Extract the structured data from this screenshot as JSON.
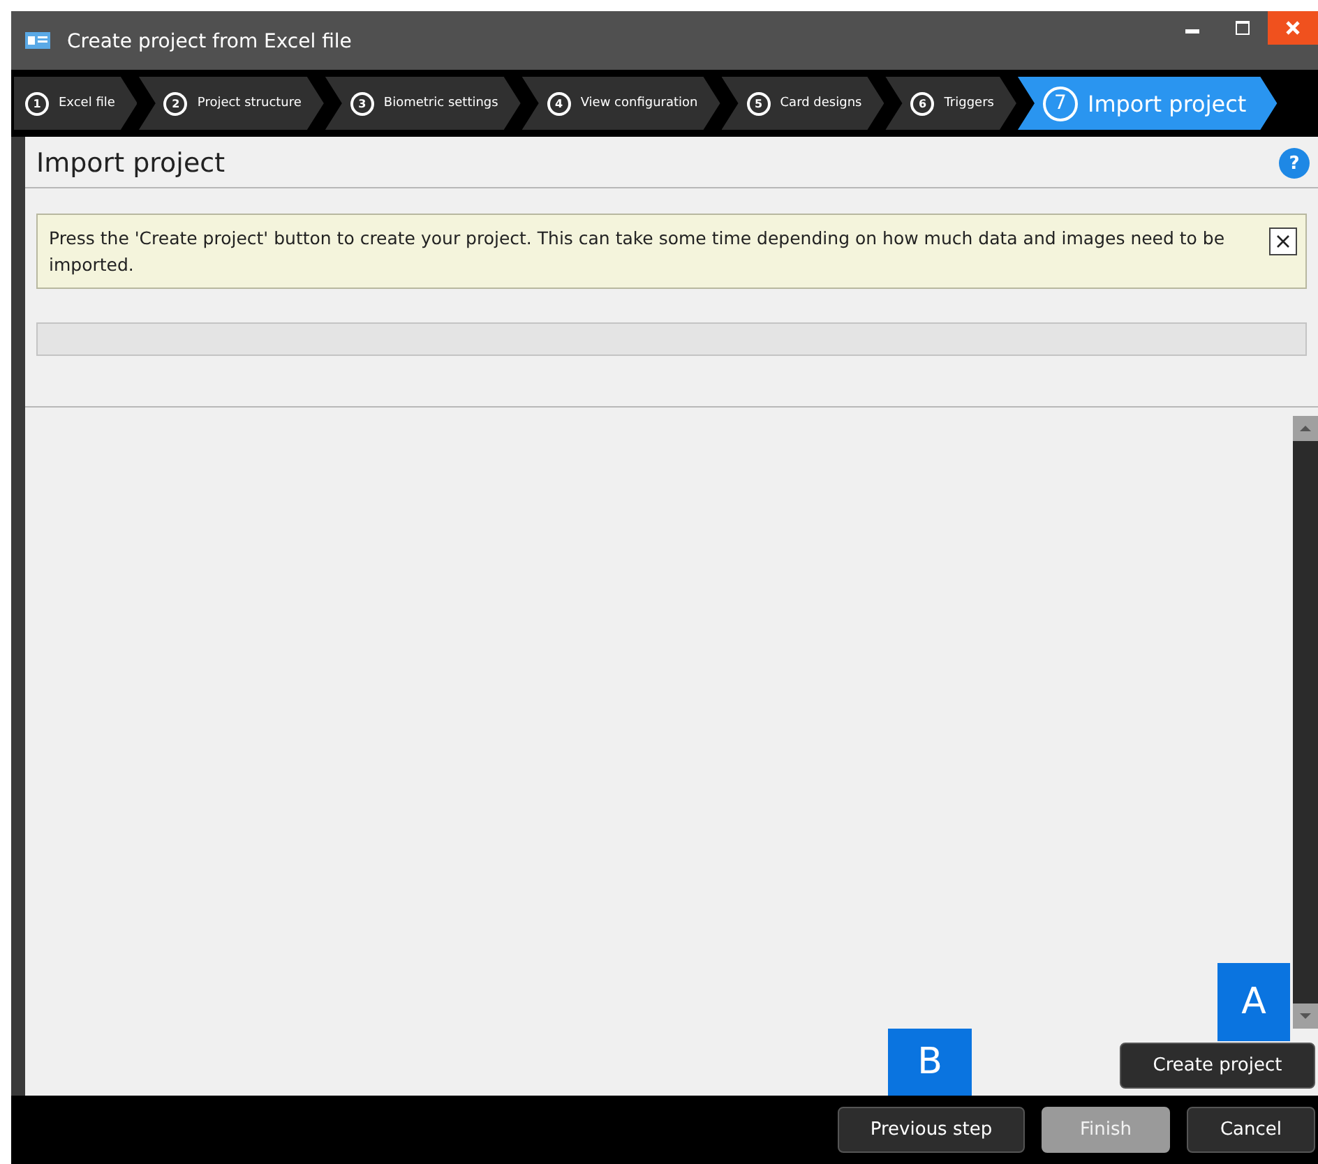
{
  "window": {
    "title": "Create project from Excel file"
  },
  "steps": [
    {
      "number": "1",
      "label": "Excel file",
      "selected": false
    },
    {
      "number": "2",
      "label": "Project structure",
      "selected": false
    },
    {
      "number": "3",
      "label": "Biometric settings",
      "selected": false
    },
    {
      "number": "4",
      "label": "View configuration",
      "selected": false
    },
    {
      "number": "5",
      "label": "Card designs",
      "selected": false
    },
    {
      "number": "6",
      "label": "Triggers",
      "selected": false
    },
    {
      "number": "7",
      "label": "Import project",
      "selected": true
    }
  ],
  "page": {
    "heading": "Import project",
    "help": "?"
  },
  "notice": {
    "text": "Press the 'Create project' button to create your project. This can take some time depending on how much data and images need to be imported."
  },
  "progress": {
    "level": 0
  },
  "create_button": {
    "label": "Create project",
    "callout": "A"
  },
  "footer_buttons": [
    {
      "label": "Previous step",
      "disabled": false,
      "callout": "B"
    },
    {
      "label": "Finish",
      "disabled": true
    },
    {
      "label": "Cancel",
      "disabled": false
    }
  ]
}
